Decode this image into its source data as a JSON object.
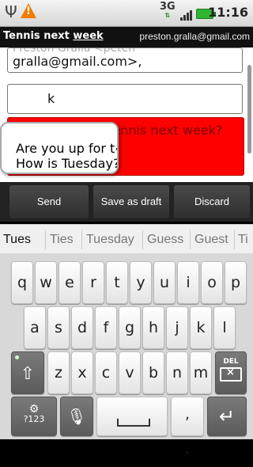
{
  "status_bar": {
    "usb_icon": "usb-icon",
    "warning_icon": "warning-icon",
    "network": "3G",
    "signal_icon": "signal-icon",
    "battery_icon": "battery-icon",
    "time": "11:16"
  },
  "title_bar": {
    "subject_prefix": "Tennis next ",
    "subject_underlined": "week",
    "account": "preston.gralla@gmail.com"
  },
  "compose": {
    "to_partial_above": "Preston Gralla <peteh",
    "to_text": "gralla@gmail.com>,",
    "subject_text": "k",
    "body_text": "Are you up for tennis next week? How is Tuesday?"
  },
  "magnifier": {
    "line1": "Are you up for t‹k",
    "line2": "How is Tuesday?"
  },
  "actions": {
    "send": "Send",
    "save_draft": "Save as draft",
    "discard": "Discard"
  },
  "suggestions": [
    "Tues",
    "Ties",
    "Tuesday",
    "Guess",
    "Guest",
    "Ti"
  ],
  "keyboard": {
    "row1": [
      "q",
      "w",
      "e",
      "r",
      "t",
      "y",
      "u",
      "i",
      "o",
      "p"
    ],
    "row2": [
      "a",
      "s",
      "d",
      "f",
      "g",
      "h",
      "j",
      "k",
      "l"
    ],
    "row3": [
      "z",
      "x",
      "c",
      "v",
      "b",
      "n",
      "m"
    ],
    "del_label": "DEL",
    "mode_label": "?123",
    "period_label": ".",
    "comma_label": ","
  },
  "colors": {
    "body_highlight": "#ff0000",
    "title_bg": "#111111",
    "keyboard_bg": "#d8d8d8"
  }
}
